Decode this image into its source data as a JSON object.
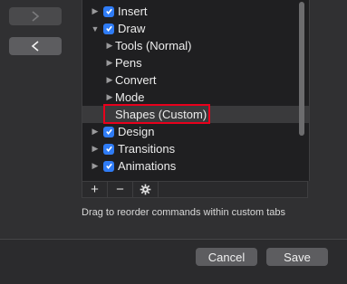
{
  "tree": {
    "items": [
      {
        "label": "Insert",
        "checked": true,
        "expanded": false,
        "level": 0
      },
      {
        "label": "Draw",
        "checked": true,
        "expanded": true,
        "level": 0
      },
      {
        "label": "Tools (Normal)",
        "checked": null,
        "expanded": false,
        "level": 1
      },
      {
        "label": "Pens",
        "checked": null,
        "expanded": false,
        "level": 1
      },
      {
        "label": "Convert",
        "checked": null,
        "expanded": false,
        "level": 1
      },
      {
        "label": "Mode",
        "checked": null,
        "expanded": false,
        "level": 1
      },
      {
        "label": "Shapes (Custom)",
        "checked": null,
        "expanded": null,
        "level": 1,
        "selected": true
      },
      {
        "label": "Design",
        "checked": true,
        "expanded": false,
        "level": 0
      },
      {
        "label": "Transitions",
        "checked": true,
        "expanded": false,
        "level": 0
      },
      {
        "label": "Animations",
        "checked": true,
        "expanded": false,
        "level": 0
      }
    ]
  },
  "toolbar": {
    "add_label": "+",
    "remove_label": "−"
  },
  "hint": "Drag to reorder commands within custom tabs",
  "footer": {
    "cancel_label": "Cancel",
    "save_label": "Save"
  },
  "colors": {
    "accent": "#2f7cf6",
    "highlight_box": "#e8001c"
  }
}
